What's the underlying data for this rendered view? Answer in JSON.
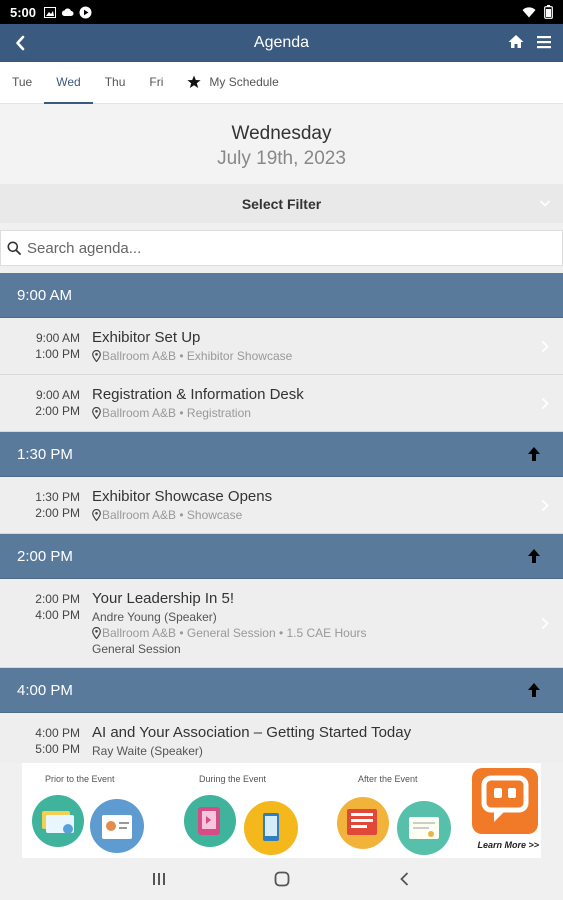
{
  "status_bar": {
    "time": "5:00"
  },
  "app_bar": {
    "title": "Agenda"
  },
  "tabs": [
    {
      "label": "Tue"
    },
    {
      "label": "Wed",
      "active": true
    },
    {
      "label": "Thu"
    },
    {
      "label": "Fri"
    },
    {
      "label": "My Schedule",
      "icon": "star-icon"
    }
  ],
  "date_header": {
    "day": "Wednesday",
    "date": "July 19th, 2023"
  },
  "filter": {
    "label": "Select Filter"
  },
  "search": {
    "placeholder": "Search agenda..."
  },
  "groups": [
    {
      "time": "9:00 AM",
      "collapse_arrow": false,
      "sessions": [
        {
          "start": "9:00 AM",
          "end": "1:00 PM",
          "title": "Exhibitor Set Up",
          "location": "Ballroom A&B • Exhibitor Showcase"
        },
        {
          "start": "9:00 AM",
          "end": "2:00 PM",
          "title": "Registration & Information Desk",
          "location": "Ballroom A&B • Registration"
        }
      ]
    },
    {
      "time": "1:30 PM",
      "collapse_arrow": true,
      "sessions": [
        {
          "start": "1:30 PM",
          "end": "2:00 PM",
          "title": "Exhibitor Showcase Opens",
          "location": "Ballroom A&B • Showcase"
        }
      ]
    },
    {
      "time": "2:00 PM",
      "collapse_arrow": true,
      "sessions": [
        {
          "start": "2:00 PM",
          "end": "4:00 PM",
          "title": "Your Leadership In 5!",
          "speaker": "Andre Young (Speaker)",
          "location": "Ballroom A&B • General Session • 1.5 CAE Hours",
          "track": "General Session"
        }
      ]
    },
    {
      "time": "4:00 PM",
      "collapse_arrow": true,
      "sessions": [
        {
          "start": "4:00 PM",
          "end": "5:00 PM",
          "title": "AI and Your Association – Getting Started Today",
          "speaker": "Ray Waite (Speaker)"
        }
      ]
    }
  ],
  "banner": {
    "prior_label": "Prior to the Event",
    "during_label": "During the Event",
    "after_label": "After the Event",
    "cta": "Learn More >>"
  },
  "colors": {
    "primary": "#3a5a80",
    "group_header": "#5a7a9c",
    "brand_orange": "#f07a28"
  }
}
